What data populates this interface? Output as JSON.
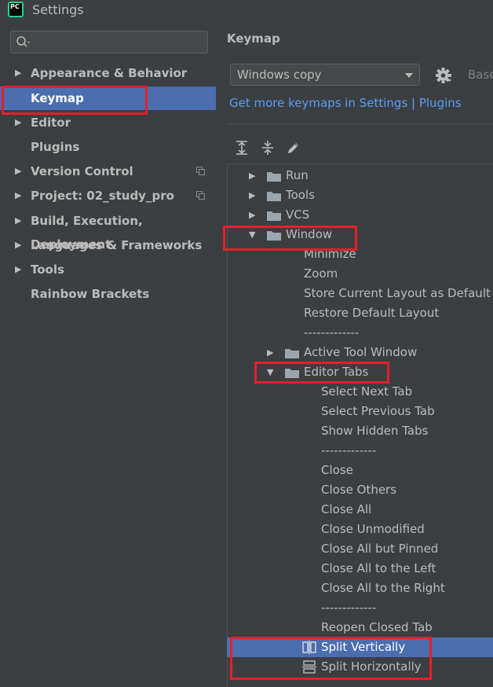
{
  "window": {
    "title": "Settings",
    "logo_text": "PC"
  },
  "sidebar": {
    "search_placeholder": "",
    "items": [
      {
        "label": "Appearance & Behavior",
        "expandable": true,
        "selected": false
      },
      {
        "label": "Keymap",
        "expandable": false,
        "selected": true
      },
      {
        "label": "Editor",
        "expandable": true,
        "selected": false
      },
      {
        "label": "Plugins",
        "expandable": false,
        "selected": false
      },
      {
        "label": "Version Control",
        "expandable": true,
        "selected": false
      },
      {
        "label": "Project: 02_study_pro",
        "expandable": true,
        "selected": false
      },
      {
        "label": "Build, Execution, Deployment",
        "expandable": true,
        "selected": false
      },
      {
        "label": "Languages & Frameworks",
        "expandable": true,
        "selected": false
      },
      {
        "label": "Tools",
        "expandable": true,
        "selected": false
      },
      {
        "label": "Rainbow Brackets",
        "expandable": false,
        "selected": false
      }
    ]
  },
  "main": {
    "title": "Keymap",
    "keymap_select": "Windows copy",
    "base_label": "Base",
    "link_text": "Get more keymaps in Settings | Plugins",
    "toolbar": [
      "expand-all-icon",
      "collapse-all-icon",
      "edit-icon"
    ],
    "tree": [
      {
        "label": "Run",
        "type": "folder",
        "expanded": false
      },
      {
        "label": "Tools",
        "type": "folder",
        "expanded": false
      },
      {
        "label": "VCS",
        "type": "folder",
        "expanded": false
      },
      {
        "label": "Window",
        "type": "folder",
        "expanded": true
      },
      {
        "label": "Minimize",
        "type": "action"
      },
      {
        "label": "Zoom",
        "type": "action"
      },
      {
        "label": "Store Current Layout as Default",
        "type": "action"
      },
      {
        "label": "Restore Default Layout",
        "type": "action"
      },
      {
        "label": "-------------",
        "type": "separator"
      },
      {
        "label": "Active Tool Window",
        "type": "folder",
        "expanded": false
      },
      {
        "label": "Editor Tabs",
        "type": "folder",
        "expanded": true
      },
      {
        "label": "Select Next Tab",
        "type": "action"
      },
      {
        "label": "Select Previous Tab",
        "type": "action"
      },
      {
        "label": "Show Hidden Tabs",
        "type": "action"
      },
      {
        "label": "-------------",
        "type": "separator"
      },
      {
        "label": "Close",
        "type": "action"
      },
      {
        "label": "Close Others",
        "type": "action"
      },
      {
        "label": "Close All",
        "type": "action"
      },
      {
        "label": "Close Unmodified",
        "type": "action"
      },
      {
        "label": "Close All but Pinned",
        "type": "action"
      },
      {
        "label": "Close All to the Left",
        "type": "action"
      },
      {
        "label": "Close All to the Right",
        "type": "action"
      },
      {
        "label": "-------------",
        "type": "separator"
      },
      {
        "label": "Reopen Closed Tab",
        "type": "action"
      },
      {
        "label": "Split Vertically",
        "type": "action",
        "icon": "split-vertically-icon",
        "selected": true
      },
      {
        "label": "Split Horizontally",
        "type": "action",
        "icon": "split-horizontally-icon"
      }
    ]
  },
  "colors": {
    "background": "#3c3f41",
    "selection": "#4b6eaf",
    "link": "#589df6",
    "highlight": "#e4202a"
  }
}
